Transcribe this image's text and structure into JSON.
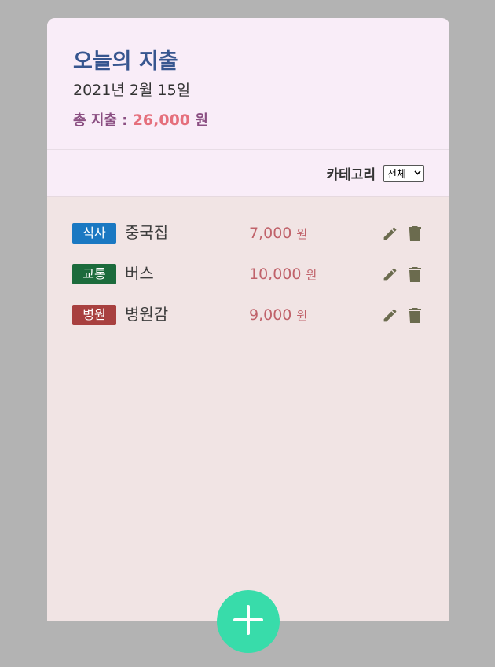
{
  "header": {
    "title": "오늘의 지출",
    "date": "2021년 2월 15일",
    "total_label": "총 지출 :",
    "total_amount": "26,000",
    "total_unit": "원"
  },
  "filter": {
    "label": "카테고리",
    "selected": "전체"
  },
  "expenses": [
    {
      "category": "식사",
      "category_color": "#1a78c2",
      "place": "중국집",
      "amount": "7,000",
      "unit": "원"
    },
    {
      "category": "교통",
      "category_color": "#1c6b3c",
      "place": "버스",
      "amount": "10,000",
      "unit": "원"
    },
    {
      "category": "병원",
      "category_color": "#a8403f",
      "place": "병원감",
      "amount": "9,000",
      "unit": "원"
    }
  ],
  "icons": {
    "edit": "pencil-icon",
    "delete": "trash-icon",
    "add": "plus-icon"
  },
  "colors": {
    "icon": "#6b6b4e",
    "fab": "#38dcaa"
  }
}
